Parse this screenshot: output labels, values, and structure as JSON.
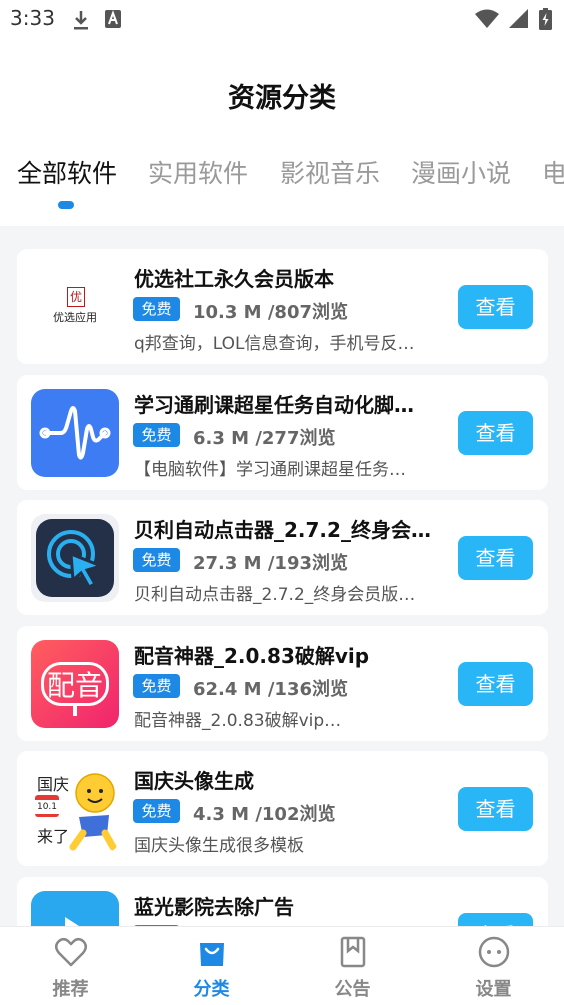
{
  "status_bar": {
    "time": "3:33",
    "icons_left": [
      "download-icon",
      "a-icon"
    ],
    "icons_right": [
      "wifi-icon",
      "signal-icon",
      "battery-icon"
    ]
  },
  "header": {
    "title": "资源分类"
  },
  "tabs": [
    {
      "label": "全部软件",
      "active": true
    },
    {
      "label": "实用软件"
    },
    {
      "label": "影视音乐"
    },
    {
      "label": "漫画小说"
    },
    {
      "label": "电"
    }
  ],
  "items": [
    {
      "title": "优选社工永久会员版本",
      "badge": "免费",
      "meta": "10.3 M /807浏览",
      "desc": "q邦查询，LOL信息查询，手机号反…",
      "button": "查看",
      "icon": "youxuan-logo-icon",
      "logo_text": "优选应用"
    },
    {
      "title": "学习通刷课超星任务自动化脚…",
      "badge": "免费",
      "meta": "6.3 M /277浏览",
      "desc": "【电脑软件】学习通刷课超星任务…",
      "button": "查看",
      "icon": "waveform-app-icon"
    },
    {
      "title": "贝利自动点击器_2.7.2_终身会…",
      "badge": "免费",
      "meta": "27.3 M /193浏览",
      "desc": "贝利自动点击器_2.7.2_终身会员版…",
      "button": "查看",
      "icon": "auto-clicker-app-icon"
    },
    {
      "title": "配音神器_2.0.83破解vip",
      "badge": "免费",
      "meta": "62.4 M /136浏览",
      "desc": "配音神器_2.0.83破解vip…",
      "button": "查看",
      "icon": "dubbing-app-icon",
      "logo_text": "配音"
    },
    {
      "title": "国庆头像生成",
      "badge": "免费",
      "meta": "4.3 M /102浏览",
      "desc": "国庆头像生成很多模板",
      "button": "查看",
      "icon": "national-day-avatar-icon",
      "logo_text_top": "国庆",
      "logo_text_bottom": "来了",
      "calendar_text": "10.1"
    },
    {
      "title": "蓝光影院去除广告",
      "badge": "免费",
      "meta": "",
      "desc": "",
      "button": "查看",
      "icon": "player-app-icon"
    }
  ],
  "bottom_nav": [
    {
      "label": "推荐",
      "icon": "heart-icon"
    },
    {
      "label": "分类",
      "icon": "bag-icon",
      "active": true
    },
    {
      "label": "公告",
      "icon": "bookmark-icon"
    },
    {
      "label": "设置",
      "icon": "face-icon"
    }
  ],
  "colors": {
    "accent": "#1e88e5",
    "button": "#29b6f6",
    "background": "#f4f5f7"
  }
}
